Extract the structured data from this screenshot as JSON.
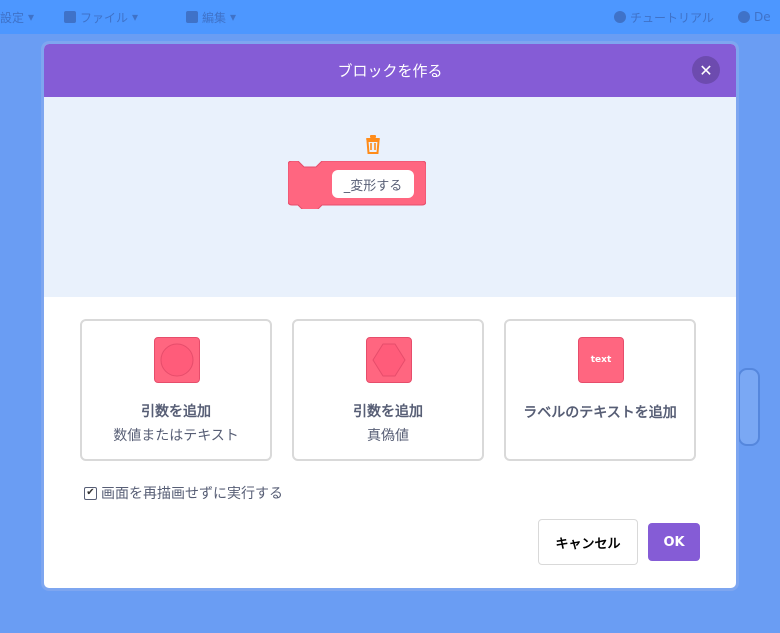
{
  "menubar": {
    "items": [
      {
        "label": "設定",
        "icon": "globe-icon"
      },
      {
        "label": "ファイル",
        "icon": "file-icon"
      },
      {
        "label": "編集",
        "icon": "edit-icon"
      },
      {
        "label": "チュートリアル",
        "icon": "lightbulb-icon"
      },
      {
        "label": "De",
        "icon": "debug-icon"
      }
    ]
  },
  "dialog": {
    "title": "ブロックを作る",
    "close_icon": "close-icon",
    "block_name": "_変形する",
    "options": [
      {
        "line1": "引数を追加",
        "line2": "数値またはテキスト",
        "icon": "number-text-input-icon"
      },
      {
        "line1": "引数を追加",
        "line2": "真偽値",
        "icon": "boolean-input-icon"
      },
      {
        "line1": "ラベルのテキストを追加",
        "line2": "",
        "icon": "label-text-icon",
        "icon_text": "text"
      }
    ],
    "run_without_refresh": {
      "label": "画面を再描画せずに実行する",
      "checked": true
    },
    "cancel_label": "キャンセル",
    "ok_label": "OK"
  },
  "colors": {
    "header": "#855cd6",
    "block": "#ff6680",
    "ok": "#855cd6",
    "preview_bg": "#e9f1fc",
    "trash": "#ff8c1a"
  }
}
